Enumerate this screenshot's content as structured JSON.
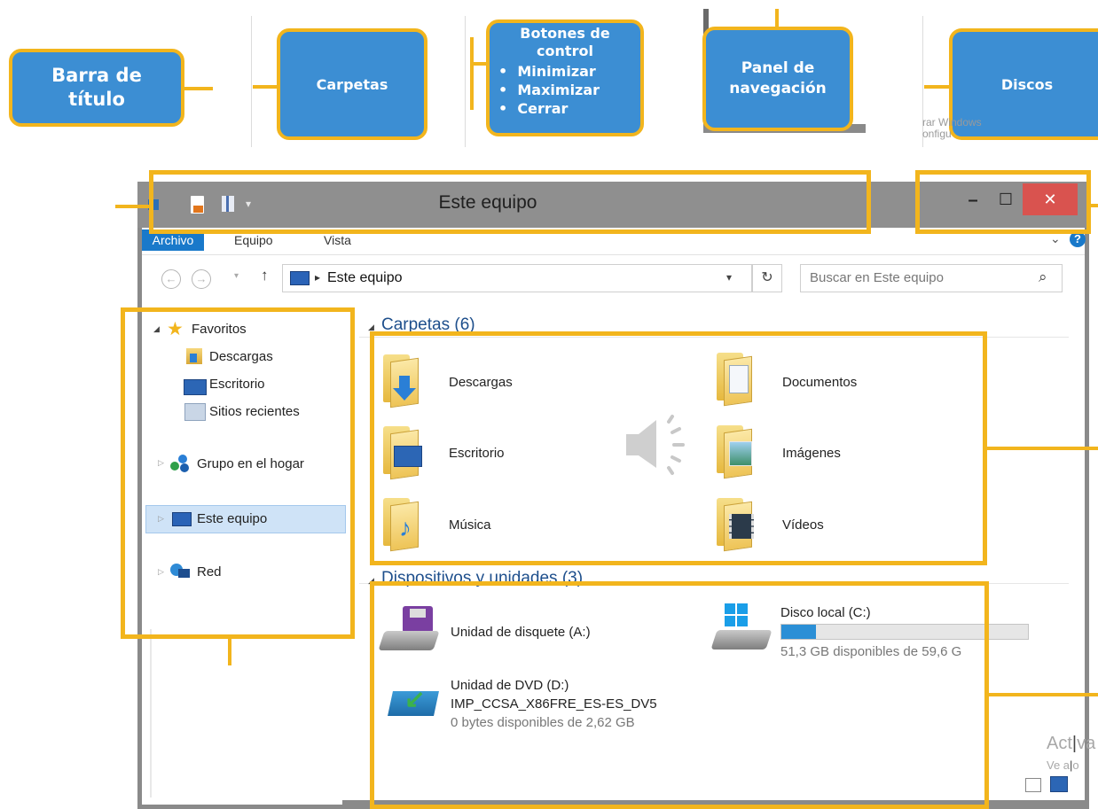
{
  "callouts": {
    "title_bar": "Barra de título",
    "folders": "Carpetas",
    "controls_title": "Botones de control",
    "controls_items": [
      "Minimizar",
      "Maximizar",
      "Cerrar"
    ],
    "nav_panel": "Panel de navegación",
    "disks": "Discos"
  },
  "watermark": {
    "top_line1": "rar Windows",
    "top_line2": "onfigu",
    "bottom_line1": "Act",
    "bottom_line1b": "va",
    "bottom_line2": "Ve a",
    "bottom_line2b": "o"
  },
  "window": {
    "title": "Este equipo",
    "minimize": "–",
    "maximize": "☐",
    "close": "✕"
  },
  "ribbon": {
    "tabs": [
      "Archivo",
      "Equipo",
      "Vista"
    ],
    "help": "?"
  },
  "address": {
    "path_item": "Este equipo",
    "search_placeholder": "Buscar en Este equipo"
  },
  "nav": {
    "favorites": "Favoritos",
    "downloads": "Descargas",
    "desktop": "Escritorio",
    "recent": "Sitios recientes",
    "homegroup": "Grupo en el hogar",
    "this_pc": "Este equipo",
    "network": "Red"
  },
  "folders": {
    "header": "Carpetas (6)",
    "items": [
      "Descargas",
      "Documentos",
      "Escritorio",
      "Imágenes",
      "Música",
      "Vídeos"
    ]
  },
  "devices": {
    "header": "Dispositivos y unidades (3)",
    "floppy": "Unidad de disquete (A:)",
    "disk_c_name": "Disco local (C:)",
    "disk_c_free": "51,3 GB disponibles de 59,6 G",
    "disk_c_used_fraction": 0.14,
    "dvd_name": "Unidad de DVD (D:)",
    "dvd_label": "IMP_CCSA_X86FRE_ES-ES_DV5",
    "dvd_free": "0 bytes disponibles de 2,62 GB"
  },
  "colors": {
    "callout_fill": "#3c8ed3",
    "callout_border": "#f2b51d",
    "close_button": "#d9534f",
    "titlebar": "#8f8f8f",
    "progress": "#2b8fd6"
  }
}
